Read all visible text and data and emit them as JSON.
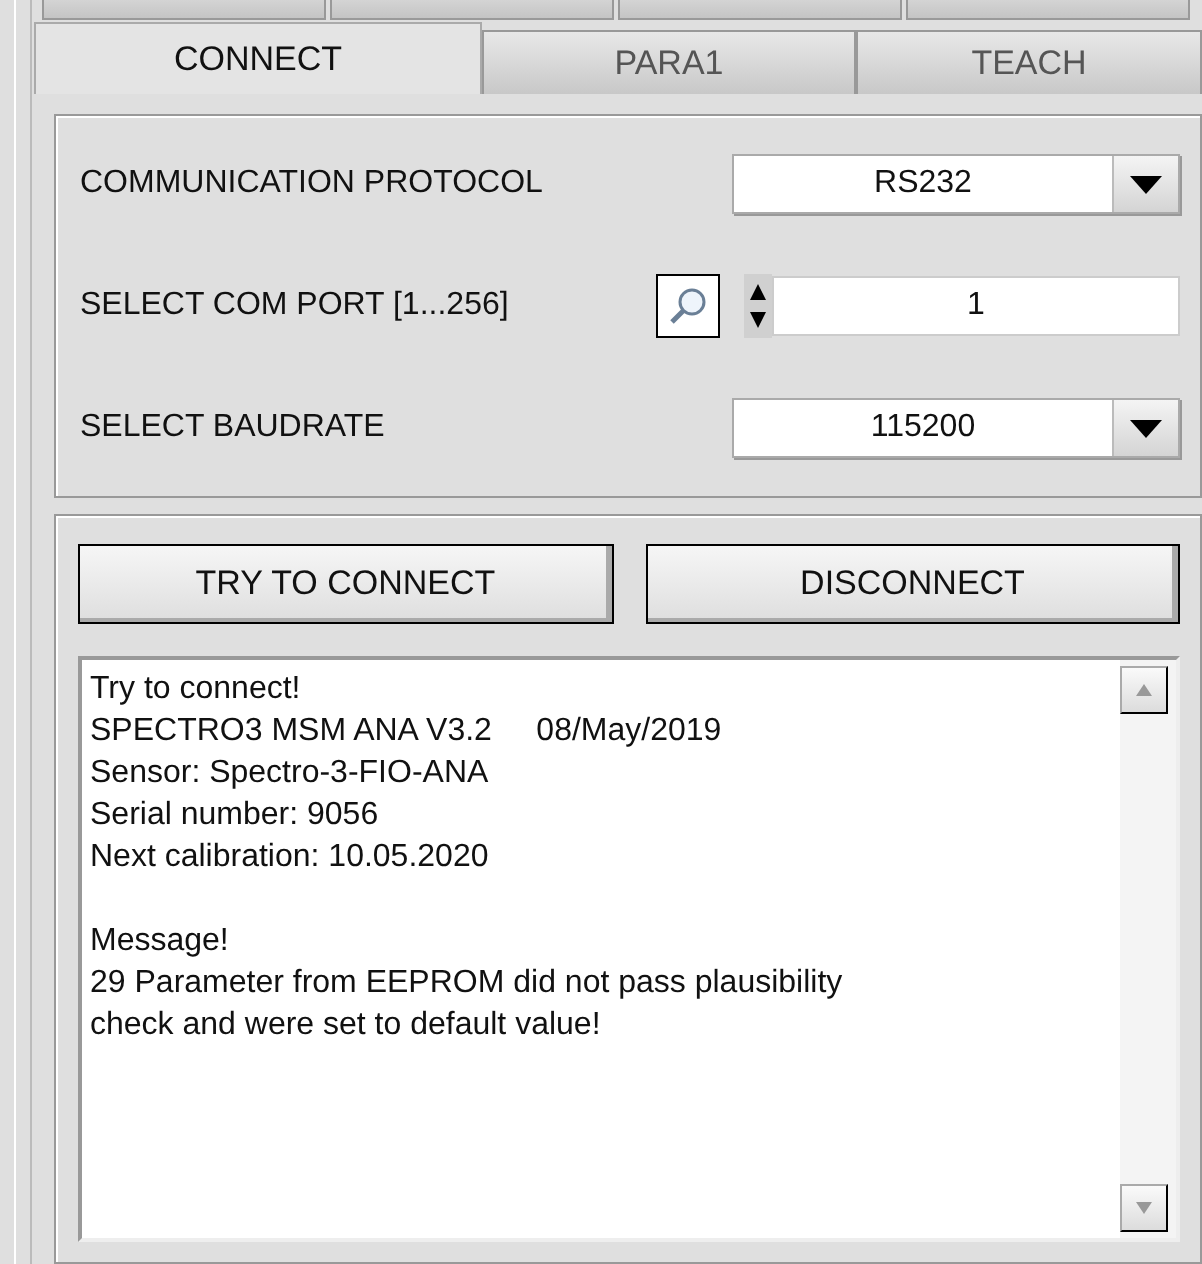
{
  "upper_tabs": [
    {
      "kind": "tab"
    },
    {
      "kind": "tab"
    },
    {
      "kind": "tab"
    },
    {
      "kind": "tab"
    }
  ],
  "tabs": [
    {
      "label": "CONNECT",
      "selected": true
    },
    {
      "label": "PARA1",
      "selected": false
    },
    {
      "label": "TEACH",
      "selected": false
    }
  ],
  "settings": [
    {
      "kind": "dropdown",
      "label": "COMMUNICATION PROTOCOL",
      "value": "RS232"
    },
    {
      "kind": "spinner",
      "label": "SELECT COM PORT [1...256]",
      "value": "1"
    },
    {
      "kind": "dropdown",
      "label": "SELECT BAUDRATE",
      "value": "115200"
    }
  ],
  "buttons": [
    "TRY TO CONNECT",
    "DISCONNECT"
  ],
  "log": [
    [
      "Try to connect!",
      "SPECTRO3 MSM ANA V3.2     08/May/2019",
      "Sensor: Spectro-3-FIO-ANA",
      "Serial number: 9056",
      "Next calibration: 10.05.2020"
    ],
    [
      "Message!",
      "29 Parameter from EEPROM did not pass plausibility",
      "check and were set to default value!"
    ]
  ]
}
